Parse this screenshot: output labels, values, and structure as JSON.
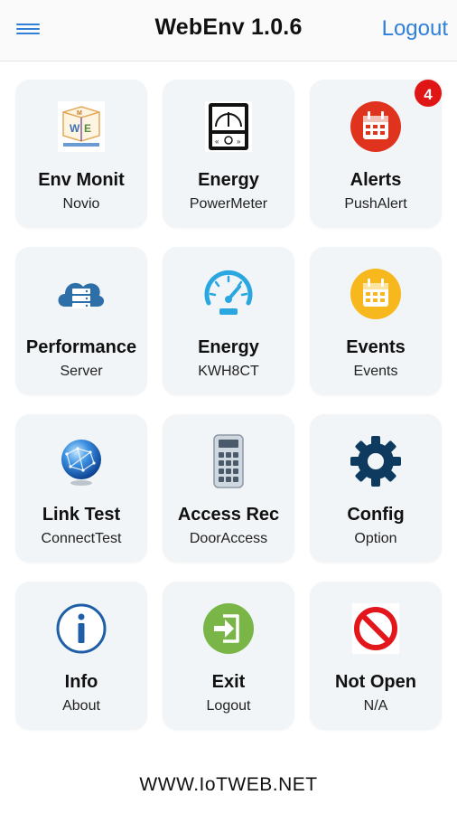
{
  "header": {
    "title": "WebEnv 1.0.6",
    "logout_label": "Logout",
    "menu_icon": "hamburger-menu-icon",
    "accent_color": "#2f80d8"
  },
  "tiles": [
    {
      "title": "Env Monit",
      "subtitle": "Novio",
      "icon": "env-monitor-icon"
    },
    {
      "title": "Energy",
      "subtitle": "PowerMeter",
      "icon": "power-meter-icon"
    },
    {
      "title": "Alerts",
      "subtitle": "PushAlert",
      "icon": "alert-calendar-icon",
      "badge": "4"
    },
    {
      "title": "Performance",
      "subtitle": "Server",
      "icon": "server-cloud-icon"
    },
    {
      "title": "Energy",
      "subtitle": "KWH8CT",
      "icon": "speedometer-icon"
    },
    {
      "title": "Events",
      "subtitle": "Events",
      "icon": "event-calendar-icon"
    },
    {
      "title": "Link Test",
      "subtitle": "ConnectTest",
      "icon": "globe-icon"
    },
    {
      "title": "Access Rec",
      "subtitle": "DoorAccess",
      "icon": "keypad-icon"
    },
    {
      "title": "Config",
      "subtitle": "Option",
      "icon": "gear-icon"
    },
    {
      "title": "Info",
      "subtitle": "About",
      "icon": "info-icon"
    },
    {
      "title": "Exit",
      "subtitle": "Logout",
      "icon": "exit-icon"
    },
    {
      "title": "Not Open",
      "subtitle": "N/A",
      "icon": "prohibited-icon"
    }
  ],
  "footer": {
    "text": "WWW.IoTWEB.NET"
  },
  "colors": {
    "tile_background": "#f1f5f7",
    "badge": "#e01515"
  }
}
